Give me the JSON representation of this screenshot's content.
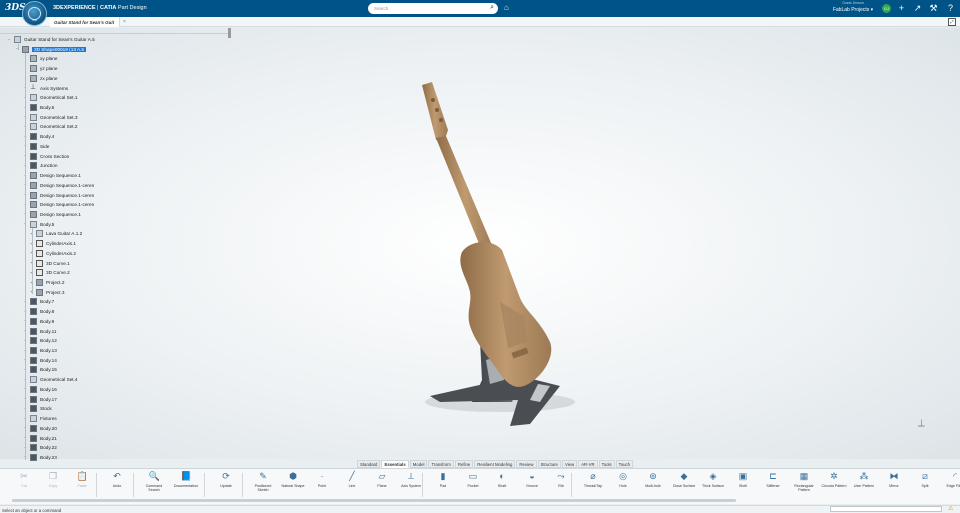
{
  "topbar": {
    "brand_left": "3DEXPERIENCE",
    "brand_sep": " | ",
    "brand_app": "CATIA",
    "app_name": " Part Design",
    "search_placeholder": "Search",
    "user_name": "Guest Jhnson",
    "project": "FabLab Projects ▾",
    "compass_label": "V.R"
  },
  "doc_tab": {
    "title": "Guitar Stand for Sean's Guit"
  },
  "tree": {
    "root": "Guitar Stand for Sean's Guitar A.5",
    "part": "3D Shape00619 (13 A.5",
    "items": [
      {
        "label": "xy plane",
        "icon": "plane"
      },
      {
        "label": "yz plane",
        "icon": "plane"
      },
      {
        "label": "zx plane",
        "icon": "plane"
      },
      {
        "label": "Axis Systems",
        "icon": "axis"
      },
      {
        "label": "Geometrical Set.1",
        "icon": "geo"
      },
      {
        "label": "Body.6",
        "icon": "body"
      },
      {
        "label": "Geometrical Set.3",
        "icon": "geo"
      },
      {
        "label": "Geometrical Set.2",
        "icon": "geo"
      },
      {
        "label": "Body.4",
        "icon": "body"
      },
      {
        "label": "Side",
        "icon": "body"
      },
      {
        "label": "Cross Section",
        "icon": "body"
      },
      {
        "label": "Junction",
        "icon": "body"
      },
      {
        "label": "Design Sequence.1",
        "icon": "seq"
      },
      {
        "label": "Design Sequence.1-ceren",
        "icon": "seq"
      },
      {
        "label": "Design Sequence.1-ceren",
        "icon": "seq"
      },
      {
        "label": "Design Sequence.1-ceren",
        "icon": "seq"
      },
      {
        "label": "Design Sequence.1",
        "icon": "seq"
      },
      {
        "label": "Body.5",
        "icon": "geo"
      }
    ],
    "sub_items": [
      {
        "label": "Lava Guitar A.1.2",
        "icon": "geo"
      },
      {
        "label": "CylinderAxis.1",
        "icon": "curve"
      },
      {
        "label": "CylinderAxis.2",
        "icon": "curve"
      },
      {
        "label": "3D Curve.1",
        "icon": "curve"
      },
      {
        "label": "3D Curve.2",
        "icon": "curve"
      },
      {
        "label": "Project.2",
        "icon": "seq"
      },
      {
        "label": "Project.3",
        "icon": "seq"
      }
    ],
    "tail_items": [
      {
        "label": "Body.7",
        "icon": "body"
      },
      {
        "label": "Body.8",
        "icon": "body"
      },
      {
        "label": "Body.9",
        "icon": "body"
      },
      {
        "label": "Body.11",
        "icon": "body"
      },
      {
        "label": "Body.12",
        "icon": "body"
      },
      {
        "label": "Body.13",
        "icon": "body"
      },
      {
        "label": "Body.14",
        "icon": "body"
      },
      {
        "label": "Body.15",
        "icon": "body"
      },
      {
        "label": "Geometrical Set.4",
        "icon": "geo"
      },
      {
        "label": "Body.16",
        "icon": "body"
      },
      {
        "label": "Body.17",
        "icon": "body"
      },
      {
        "label": "Stock",
        "icon": "body"
      },
      {
        "label": "Fixtures",
        "icon": "geo"
      },
      {
        "label": "Body.20",
        "icon": "body"
      },
      {
        "label": "Body.21",
        "icon": "body"
      },
      {
        "label": "Body.22",
        "icon": "body"
      },
      {
        "label": "Body.23",
        "icon": "body"
      }
    ]
  },
  "section_tabs": [
    "Standard",
    "Essentials",
    "Model",
    "Transform",
    "Refine",
    "Resilient Modeling",
    "Review",
    "Structure",
    "View",
    "AR-VR",
    "Tools",
    "Touch"
  ],
  "active_section": "Essentials",
  "commands": [
    {
      "label": "Cut",
      "icon": "scissors-icon",
      "glyph": "✂",
      "enabled": false
    },
    {
      "label": "Copy",
      "icon": "copy-icon",
      "glyph": "❐",
      "enabled": false
    },
    {
      "label": "Paste",
      "icon": "paste-icon",
      "glyph": "📋",
      "enabled": false
    },
    {
      "label": "Undo",
      "icon": "undo-icon",
      "glyph": "↶",
      "enabled": true
    },
    {
      "label": "Command Search",
      "icon": "command-search-icon",
      "glyph": "🔍",
      "enabled": true
    },
    {
      "label": "Documentation",
      "icon": "documentation-icon",
      "glyph": "📘",
      "enabled": true
    },
    {
      "label": "Update",
      "icon": "update-icon",
      "glyph": "⟳",
      "enabled": true
    },
    {
      "label": "Positioned Sketch",
      "icon": "sketch-icon",
      "glyph": "✎",
      "enabled": true
    },
    {
      "label": "Natural Shape",
      "icon": "natural-shape-icon",
      "glyph": "⬢",
      "enabled": true
    },
    {
      "label": "Point",
      "icon": "point-icon",
      "glyph": "·",
      "enabled": true
    },
    {
      "label": "Line",
      "icon": "line-icon",
      "glyph": "╱",
      "enabled": true
    },
    {
      "label": "Plane",
      "icon": "plane-icon",
      "glyph": "▱",
      "enabled": true
    },
    {
      "label": "Axis System",
      "icon": "axis-system-icon",
      "glyph": "⟂",
      "enabled": true
    },
    {
      "label": "Pad",
      "icon": "pad-icon",
      "glyph": "▮",
      "enabled": true
    },
    {
      "label": "Pocket",
      "icon": "pocket-icon",
      "glyph": "▭",
      "enabled": true
    },
    {
      "label": "Shaft",
      "icon": "shaft-icon",
      "glyph": "◐",
      "enabled": true
    },
    {
      "label": "Groove",
      "icon": "groove-icon",
      "glyph": "◒",
      "enabled": true
    },
    {
      "label": "Rib",
      "icon": "rib-icon",
      "glyph": "⤳",
      "enabled": true
    },
    {
      "label": "Thread/Tap",
      "icon": "thread-icon",
      "glyph": "⌀",
      "enabled": true
    },
    {
      "label": "Hole",
      "icon": "hole-icon",
      "glyph": "◎",
      "enabled": true
    },
    {
      "label": "Multi-hole",
      "icon": "multi-hole-icon",
      "glyph": "⊚",
      "enabled": true
    },
    {
      "label": "Close Surface",
      "icon": "close-surface-icon",
      "glyph": "◆",
      "enabled": true
    },
    {
      "label": "Thick Surface",
      "icon": "thick-surface-icon",
      "glyph": "◈",
      "enabled": true
    },
    {
      "label": "Shell",
      "icon": "shell-icon",
      "glyph": "▣",
      "enabled": true
    },
    {
      "label": "Stiffener",
      "icon": "stiffener-icon",
      "glyph": "⊏",
      "enabled": true
    },
    {
      "label": "Rectangular Pattern",
      "icon": "rect-pattern-icon",
      "glyph": "▦",
      "enabled": true
    },
    {
      "label": "Circular Pattern",
      "icon": "circ-pattern-icon",
      "glyph": "✲",
      "enabled": true
    },
    {
      "label": "User Pattern",
      "icon": "user-pattern-icon",
      "glyph": "⁂",
      "enabled": true
    },
    {
      "label": "Mirror",
      "icon": "mirror-icon",
      "glyph": "⧓",
      "enabled": true
    },
    {
      "label": "Split",
      "icon": "split-icon",
      "glyph": "⧄",
      "enabled": true
    },
    {
      "label": "Edge Fillet",
      "icon": "edge-fillet-icon",
      "glyph": "◜",
      "enabled": true
    }
  ],
  "status": {
    "prompt": "Select an object or a command"
  },
  "colors": {
    "topbar": "#005386",
    "selection": "#1d79d6",
    "guitar": "#b08b62",
    "stand": "#55595d"
  }
}
